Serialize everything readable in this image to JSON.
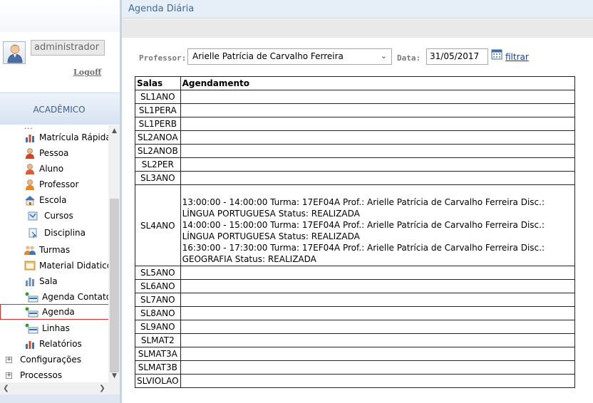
{
  "page": {
    "title": "Agenda Diária"
  },
  "user": {
    "name": "administrador",
    "logoff_label": "Logoff"
  },
  "sidebar": {
    "section_title": "ACADÊMICO",
    "dots": "...",
    "items": [
      {
        "label": "Matrícula Rápida",
        "icon": "bar-chart-icon"
      },
      {
        "label": "Pessoa",
        "icon": "person-icon"
      },
      {
        "label": "Aluno",
        "icon": "student-icon"
      },
      {
        "label": "Professor",
        "icon": "teacher-icon"
      },
      {
        "label": "Escola",
        "icon": "school-icon"
      },
      {
        "label": "Cursos",
        "icon": "courses-icon"
      },
      {
        "label": "Disciplina",
        "icon": "discipline-icon"
      },
      {
        "label": "Turmas",
        "icon": "classes-icon"
      },
      {
        "label": "Material Didatico",
        "icon": "material-icon"
      },
      {
        "label": "Sala",
        "icon": "room-icon"
      },
      {
        "label": "Agenda Contato",
        "icon": "agenda-contact-icon"
      },
      {
        "label": "Agenda",
        "icon": "agenda-icon"
      },
      {
        "label": "Linhas",
        "icon": "lines-icon"
      },
      {
        "label": "Relatórios",
        "icon": "reports-icon"
      }
    ],
    "tree": [
      {
        "label": "Configurações",
        "expander": "+"
      },
      {
        "label": "Processos",
        "expander": "+"
      }
    ],
    "selected": "Agenda"
  },
  "filters": {
    "professor_label": "Professor:",
    "professor_value": "Arielle Patrícia de Carvalho Ferreira",
    "date_label": "Data:",
    "date_value": "31/05/2017",
    "filter_link": "filtrar"
  },
  "table": {
    "headers": [
      "Salas",
      "Agendamento"
    ],
    "rows": [
      {
        "sala": "SL1ANO",
        "agendamento": []
      },
      {
        "sala": "SL1PERA",
        "agendamento": []
      },
      {
        "sala": "SL1PERB",
        "agendamento": []
      },
      {
        "sala": "SL2ANOA",
        "agendamento": []
      },
      {
        "sala": "SL2ANOB",
        "agendamento": []
      },
      {
        "sala": "SL2PER",
        "agendamento": []
      },
      {
        "sala": "SL3ANO",
        "agendamento": []
      },
      {
        "sala": "SL4ANO",
        "agendamento": [
          "13:00:00 - 14:00:00 Turma: 17EF04A Prof.: Arielle Patrícia de Carvalho Ferreira Disc.: LÍNGUA PORTUGUESA Status: REALIZADA",
          "14:00:00 - 15:00:00 Turma: 17EF04A Prof.: Arielle Patrícia de Carvalho Ferreira Disc.: LÍNGUA PORTUGUESA Status: REALIZADA",
          "16:30:00 - 17:30:00 Turma: 17EF04A Prof.: Arielle Patrícia de Carvalho Ferreira Disc.: GEOGRAFIA Status: REALIZADA"
        ]
      },
      {
        "sala": "SL5ANO",
        "agendamento": []
      },
      {
        "sala": "SL6ANO",
        "agendamento": []
      },
      {
        "sala": "SL7ANO",
        "agendamento": []
      },
      {
        "sala": "SL8ANO",
        "agendamento": []
      },
      {
        "sala": "SL9ANO",
        "agendamento": []
      },
      {
        "sala": "SLMAT2",
        "agendamento": []
      },
      {
        "sala": "SLMAT3A",
        "agendamento": []
      },
      {
        "sala": "SLMAT3B",
        "agendamento": []
      },
      {
        "sala": "SLVIOLAO",
        "agendamento": []
      }
    ]
  },
  "colors": {
    "accent": "#3b6ea5",
    "link": "#0b3ebf",
    "selection_border": "#e32b2b"
  }
}
